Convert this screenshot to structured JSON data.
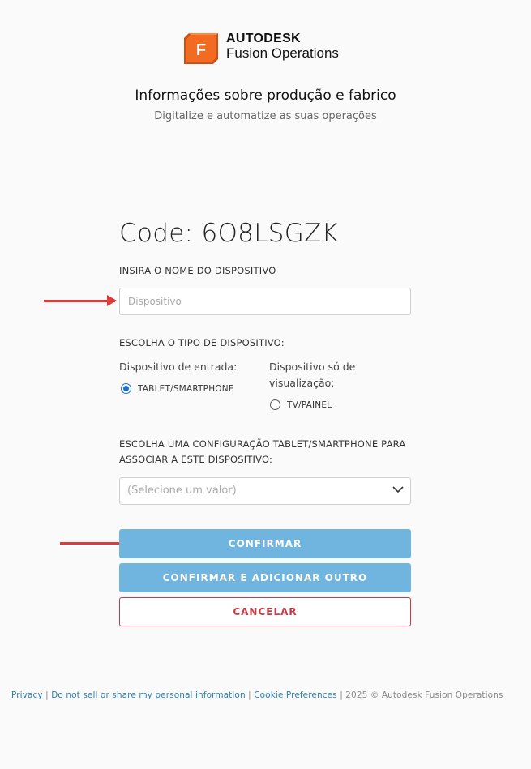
{
  "brand": {
    "name": "AUTODESK",
    "product": "Fusion Operations",
    "logo_letter": "F"
  },
  "header": {
    "title": "Informações sobre produção e fabrico",
    "subtitle": "Digitalize e automatize as suas operações"
  },
  "form": {
    "code": "Code: 6O8LSGZK",
    "device_name_label": "INSIRA O NOME DO DISPOSITIVO",
    "device_name_placeholder": "Dispositivo",
    "device_name_value": "",
    "device_type_label": "ESCOLHA O TIPO DE DISPOSITIVO:",
    "input_device_label": "Dispositivo de entrada:",
    "view_device_label_line1": "Dispositivo só de",
    "view_device_label_line2": "visualização:",
    "options": [
      {
        "label": "TABLET/SMARTPHONE",
        "checked": true
      },
      {
        "label": "TV/PAINEL",
        "checked": false
      }
    ],
    "config_label_line1": "ESCOLHA UMA CONFIGURAÇÃO TABLET/SMARTPHONE PARA",
    "config_label_line2": "ASSOCIAR A ESTE DISPOSITIVO:",
    "config_select_value": "(Selecione um valor)"
  },
  "buttons": {
    "confirm": "CONFIRMAR",
    "confirm_add": "CONFIRMAR E ADICIONAR OUTRO",
    "cancel": "CANCELAR"
  },
  "footer": {
    "privacy": "Privacy",
    "sep": " | ",
    "do_not_sell": "Do not sell or share my personal information",
    "cookies": "Cookie Preferences",
    "copyright": "2025 © Autodesk Fusion Operations"
  },
  "colors": {
    "primary_button": "#6fb5e0",
    "cancel_accent": "#c33c47",
    "logo_orange": "#f26b21",
    "annotation_arrow": "#e03a3a",
    "radio_checked": "#1a6fd6",
    "link": "#2b7fb0"
  },
  "icons": {
    "logo": "autodesk-fusion-logo-icon",
    "select": "chevron-down-icon",
    "annotation": "red-arrow-icon"
  }
}
